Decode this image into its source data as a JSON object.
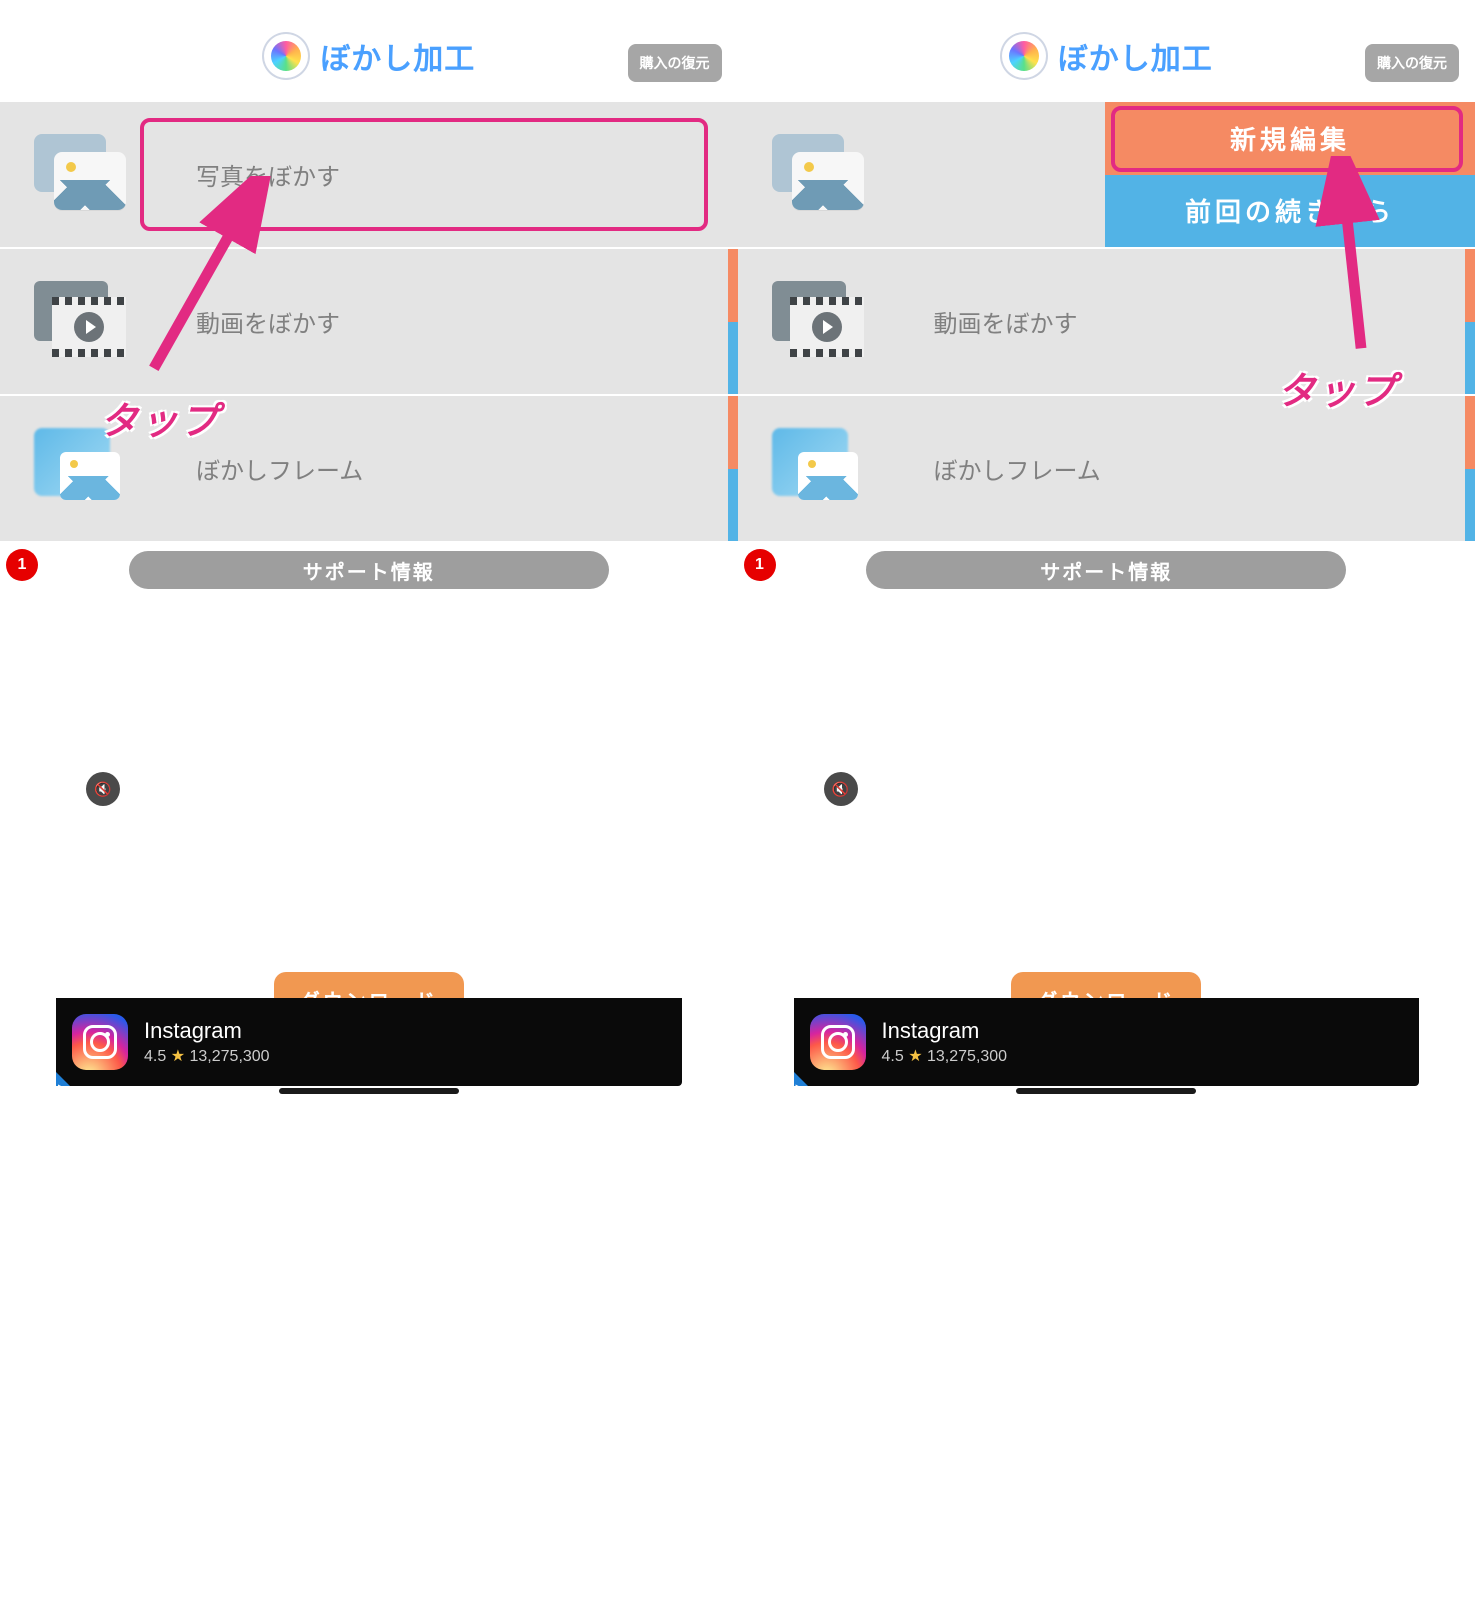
{
  "header": {
    "title": "ぼかし加工",
    "restore_label": "購入の復元"
  },
  "features": {
    "photo": "写真をぼかす",
    "video": "動画をぼかす",
    "frame": "ぼかしフレーム"
  },
  "expanded": {
    "new_edit": "新規編集",
    "continue": "前回の続きから"
  },
  "support": {
    "label": "サポート情報",
    "badge": "1"
  },
  "annotation": {
    "tap": "タップ"
  },
  "ad": {
    "download": "ダウンロード",
    "app_name": "Instagram",
    "rating": "4.5",
    "reviews": "13,275,300",
    "star": "★",
    "mute_icon": "🔇"
  }
}
